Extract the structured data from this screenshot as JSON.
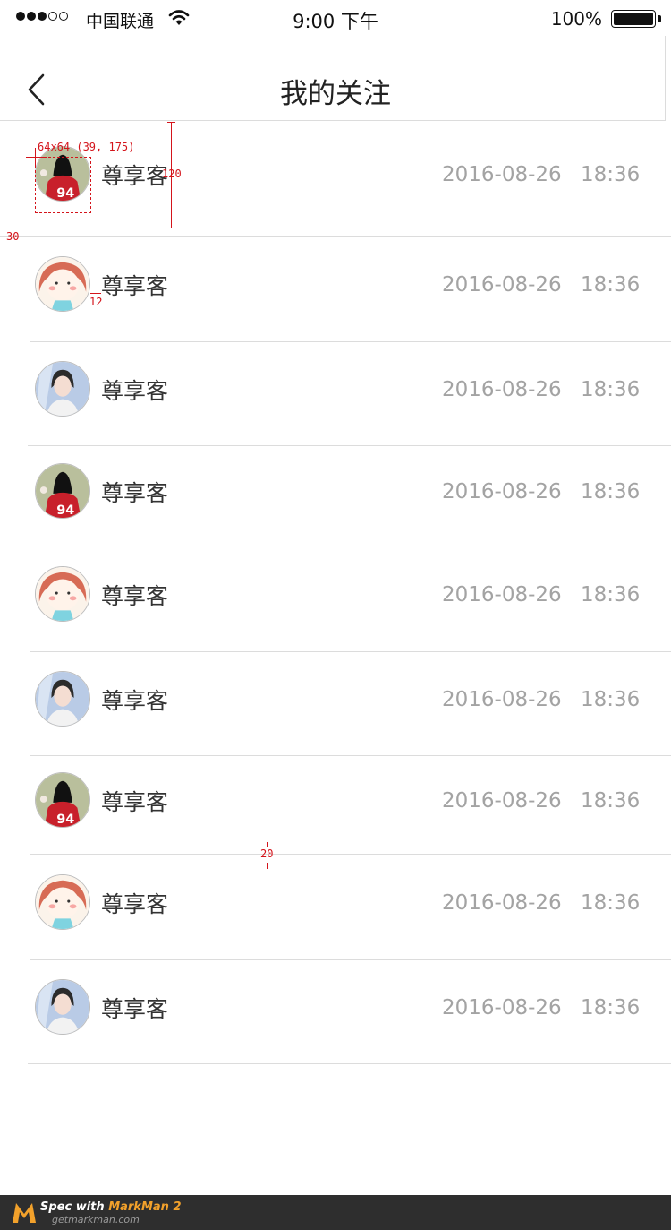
{
  "status_bar": {
    "carrier": "中国联通",
    "time": "9:00 下午",
    "battery": "100%"
  },
  "nav": {
    "title": "我的关注"
  },
  "list": {
    "items": [
      {
        "name": "尊享客",
        "date": "2016-08-26",
        "time": "18:36",
        "avatar": "jersey-94-avatar"
      },
      {
        "name": "尊享客",
        "date": "2016-08-26",
        "time": "18:36",
        "avatar": "cartoon-girl-avatar"
      },
      {
        "name": "尊享客",
        "date": "2016-08-26",
        "time": "18:36",
        "avatar": "photo-woman-avatar"
      },
      {
        "name": "尊享客",
        "date": "2016-08-26",
        "time": "18:36",
        "avatar": "jersey-94-avatar"
      },
      {
        "name": "尊享客",
        "date": "2016-08-26",
        "time": "18:36",
        "avatar": "cartoon-girl-avatar"
      },
      {
        "name": "尊享客",
        "date": "2016-08-26",
        "time": "18:36",
        "avatar": "photo-woman-avatar"
      },
      {
        "name": "尊享客",
        "date": "2016-08-26",
        "time": "18:36",
        "avatar": "jersey-94-avatar"
      },
      {
        "name": "尊享客",
        "date": "2016-08-26",
        "time": "18:36",
        "avatar": "cartoon-girl-avatar"
      },
      {
        "name": "尊享客",
        "date": "2016-08-26",
        "time": "18:36",
        "avatar": "photo-woman-avatar"
      }
    ]
  },
  "annotations": {
    "avatar_spec": "64x64 (39, 175)",
    "row_height": "120",
    "left_margin": "30",
    "gap_avatar_name": "12",
    "divider_gap": "20"
  },
  "footer": {
    "spec_prefix": "Spec with ",
    "brand": "MarkMan 2",
    "url": "getmarkman.com"
  }
}
